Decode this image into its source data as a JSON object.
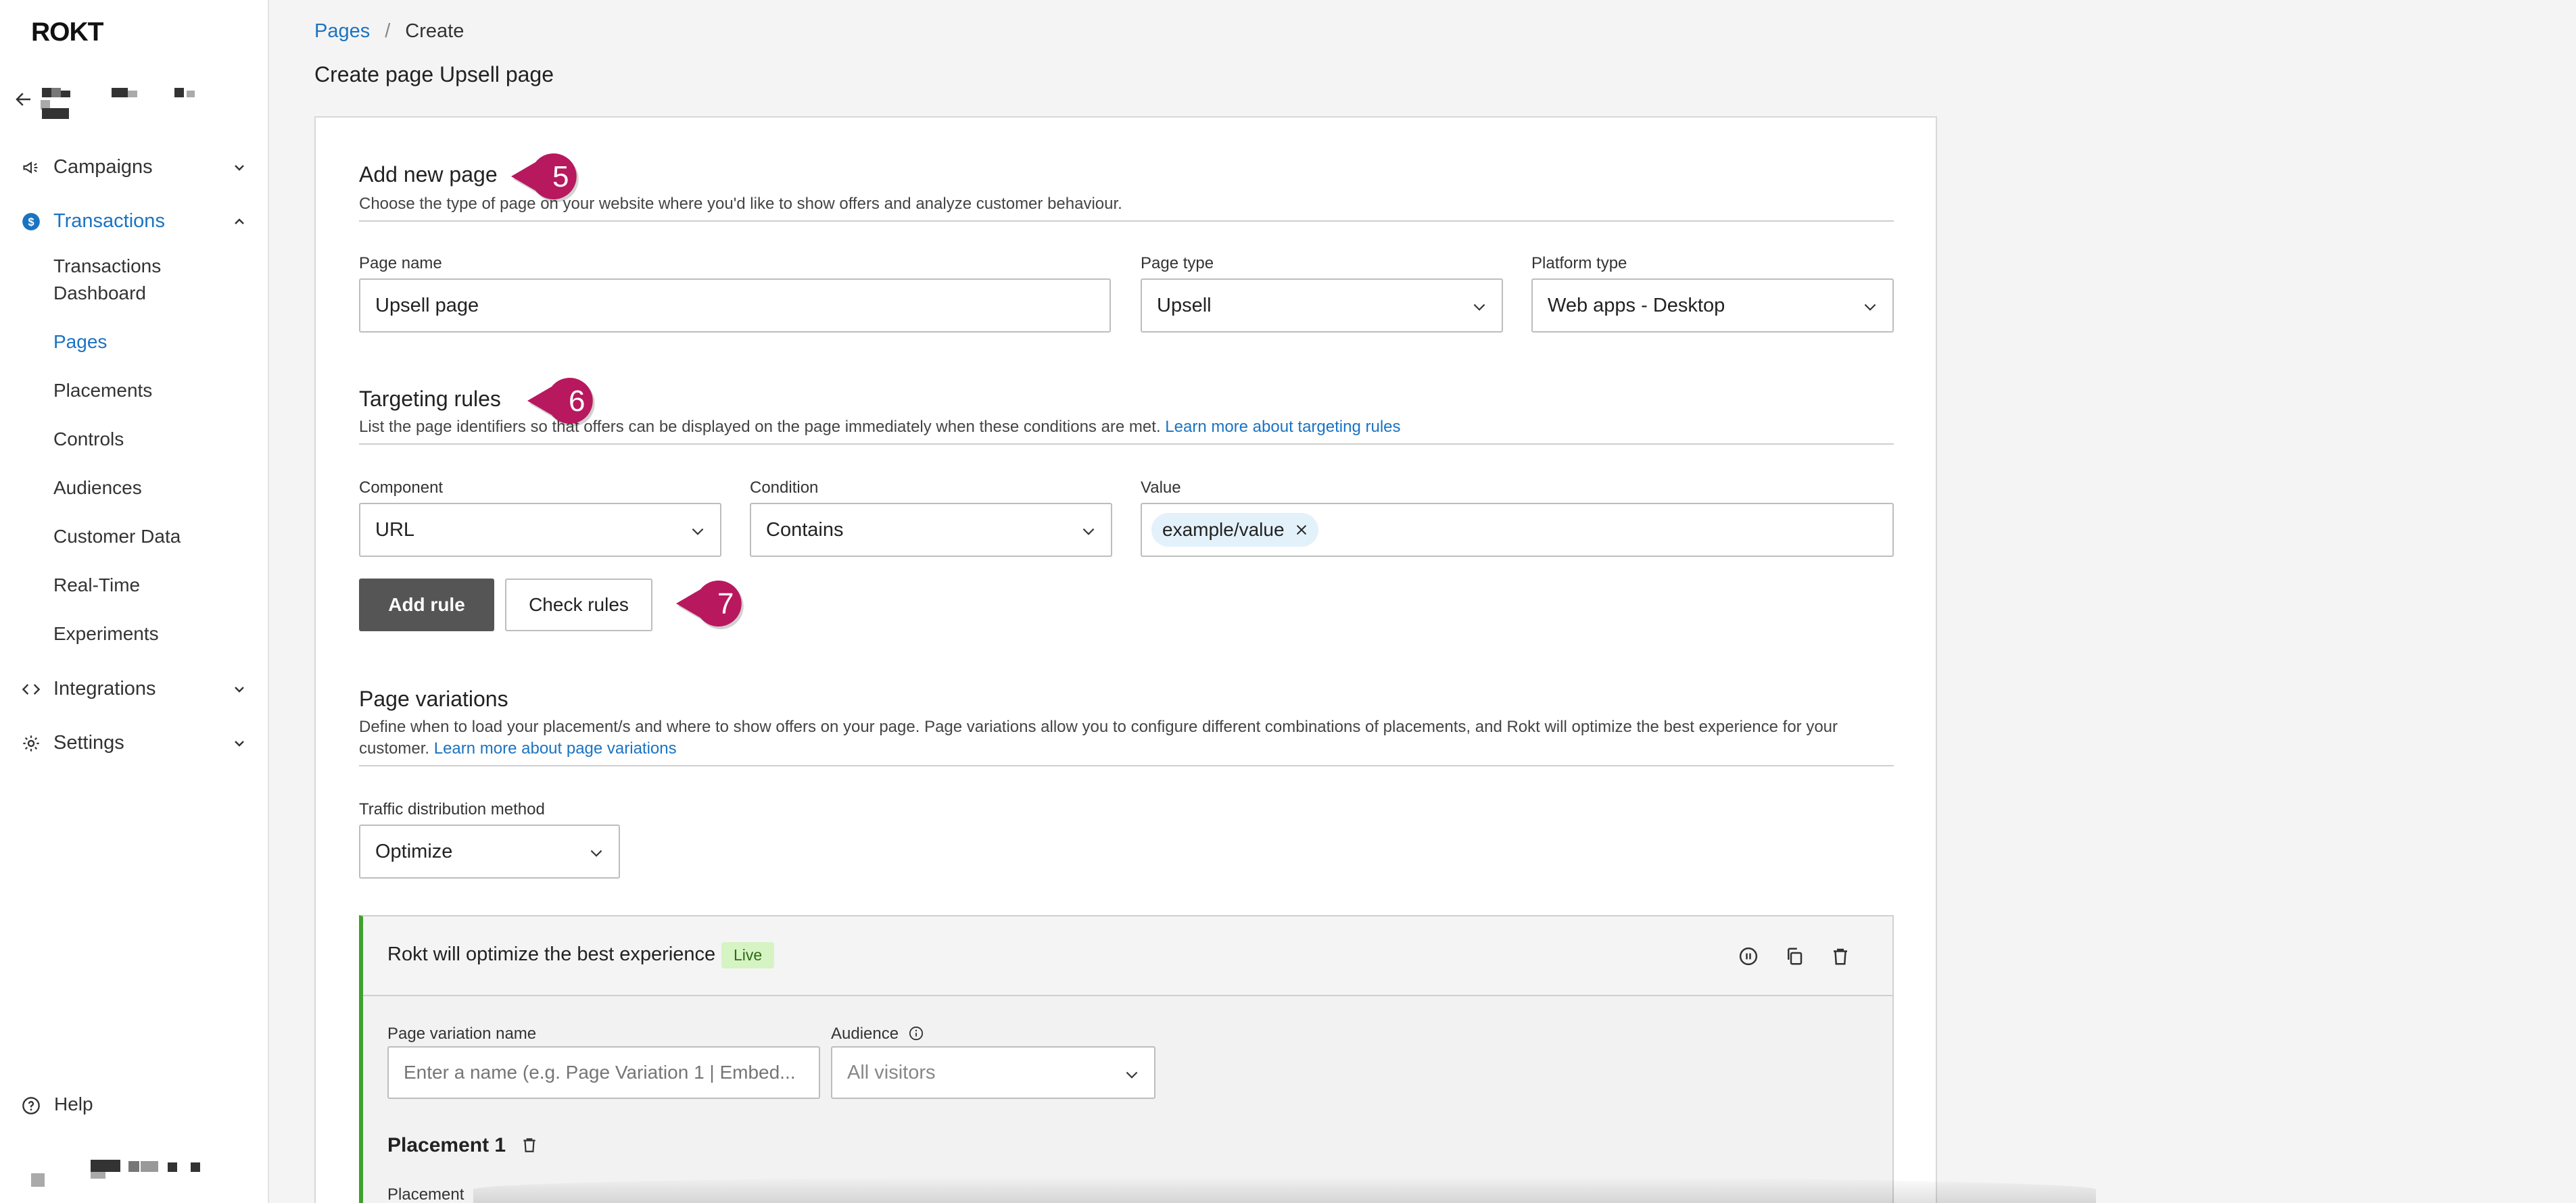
{
  "app": {
    "logo": "ROKT"
  },
  "sidebar": {
    "sections": [
      {
        "label": "Campaigns",
        "icon": "megaphone-icon",
        "expanded": false
      },
      {
        "label": "Transactions",
        "icon": "dollar-icon",
        "expanded": true,
        "active": true
      },
      {
        "label": "Integrations",
        "icon": "code-icon",
        "expanded": false
      },
      {
        "label": "Settings",
        "icon": "gear-icon",
        "expanded": false
      }
    ],
    "transactions_items": [
      {
        "label": "Transactions\nDashboard"
      },
      {
        "label": "Pages",
        "active": true
      },
      {
        "label": "Placements"
      },
      {
        "label": "Controls"
      },
      {
        "label": "Audiences"
      },
      {
        "label": "Customer Data"
      },
      {
        "label": "Real-Time"
      },
      {
        "label": "Experiments"
      }
    ],
    "help_label": "Help"
  },
  "breadcrumb": {
    "parent": "Pages",
    "current": "Create"
  },
  "page_title": "Create page Upsell page",
  "add_page": {
    "title": "Add new page",
    "description": "Choose the type of page on your website where you'd like to show offers and analyze customer behaviour.",
    "page_name_label": "Page name",
    "page_name_value": "Upsell page",
    "page_type_label": "Page type",
    "page_type_value": "Upsell",
    "platform_type_label": "Platform type",
    "platform_type_value": "Web apps - Desktop"
  },
  "targeting": {
    "title": "Targeting rules",
    "description": "List the page identifiers so that offers can be displayed on the page immediately when these conditions are met.",
    "link": "Learn more about targeting rules",
    "component_label": "Component",
    "component_value": "URL",
    "condition_label": "Condition",
    "condition_value": "Contains",
    "value_label": "Value",
    "value_chip": "example/value",
    "add_rule": "Add rule",
    "check_rules": "Check rules"
  },
  "variations": {
    "title": "Page variations",
    "description": "Define when to load your placement/s and where to show offers on your page. Page variations allow you to configure different combinations of placements, and Rokt will optimize the best experience for your customer.",
    "link": "Learn more about page variations",
    "traffic_label": "Traffic distribution method",
    "traffic_value": "Optimize",
    "variation_title": "Rokt will optimize the best experience",
    "variation_badge": "Live",
    "variation_name_label": "Page variation name",
    "variation_name_placeholder": "Enter a name (e.g. Page Variation 1 | Embed...",
    "audience_label": "Audience",
    "audience_value": "All visitors",
    "placement_title": "Placement 1",
    "placement_label": "Placement"
  },
  "callouts": [
    "5",
    "6",
    "7"
  ],
  "colors": {
    "accent": "#1a73c2",
    "callout": "#b8185e",
    "live_border": "#3fa12a",
    "live_badge_bg": "#d6f3c4"
  }
}
